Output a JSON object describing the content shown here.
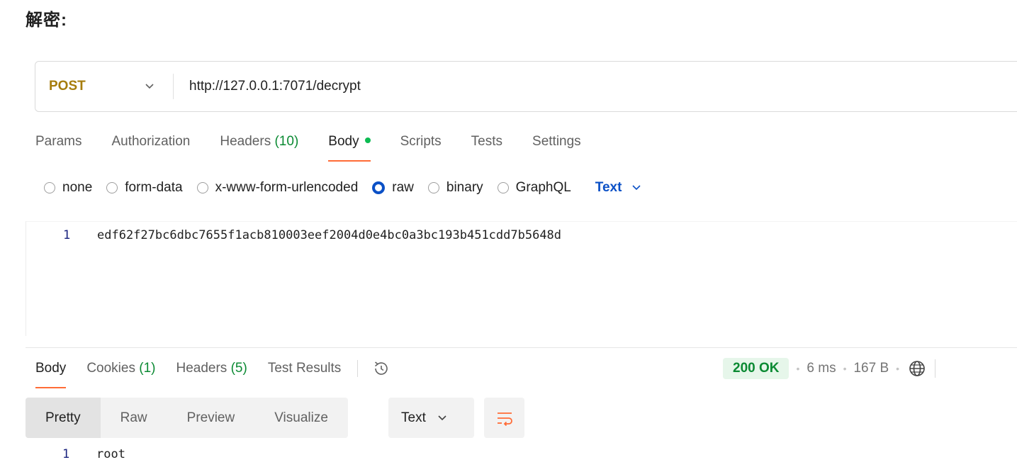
{
  "heading": "解密:",
  "request": {
    "method": "POST",
    "url": "http://127.0.0.1:7071/decrypt"
  },
  "request_tabs": [
    {
      "label": "Params",
      "count": ""
    },
    {
      "label": "Authorization",
      "count": ""
    },
    {
      "label": "Headers",
      "count": "(10)"
    },
    {
      "label": "Body",
      "count": ""
    },
    {
      "label": "Scripts",
      "count": ""
    },
    {
      "label": "Tests",
      "count": ""
    },
    {
      "label": "Settings",
      "count": ""
    }
  ],
  "body_types": [
    "none",
    "form-data",
    "x-www-form-urlencoded",
    "raw",
    "binary",
    "GraphQL"
  ],
  "body_type_selected": "raw",
  "body_language": "Text",
  "editor": {
    "line_number": "1",
    "content": "edf62f27bc6dbc7655f1acb810003eef2004d0e4bc0a3bc193b451cdd7b5648d"
  },
  "response_tabs": [
    {
      "label": "Body",
      "count": ""
    },
    {
      "label": "Cookies",
      "count": "(1)"
    },
    {
      "label": "Headers",
      "count": "(5)"
    },
    {
      "label": "Test Results",
      "count": ""
    }
  ],
  "response_meta": {
    "status": "200 OK",
    "time": "6 ms",
    "size": "167 B"
  },
  "view_modes": [
    "Pretty",
    "Raw",
    "Preview",
    "Visualize"
  ],
  "view_mode_selected": "Pretty",
  "response_format": "Text",
  "response": {
    "line_number": "1",
    "content": "root"
  },
  "icons": {
    "method_dropdown": "chevron-down-icon",
    "history": "history-icon",
    "network": "globe-icon",
    "wrap": "wrap-lines-icon"
  },
  "colors": {
    "accent_tab": "#ff6c37",
    "method": "#a67d0d",
    "link_blue": "#0b50c6",
    "success_green": "#0b8a33"
  }
}
